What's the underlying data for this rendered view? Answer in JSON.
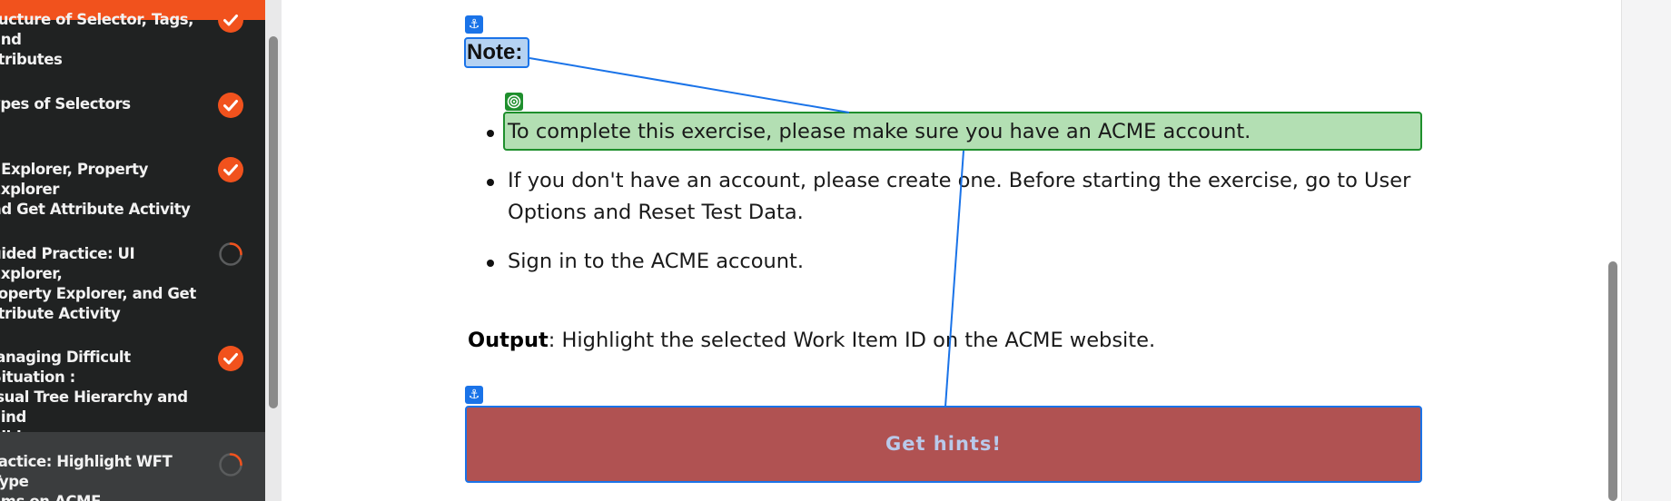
{
  "sidebar": {
    "lessons": [
      {
        "title": "ructure of Selector, Tags, and\nttributes",
        "status": "done"
      },
      {
        "title": "ypes of Selectors",
        "status": "done"
      },
      {
        "title": "I Explorer, Property Explorer\nnd Get Attribute Activity",
        "status": "done"
      },
      {
        "title": "uided Practice: UI Explorer,\nroperty Explorer, and Get\nttribute Activity",
        "status": "in-progress"
      },
      {
        "title": "lanaging Difficult Situation :\nisual Tree Hierarchy and Find\nhildren",
        "status": "done"
      },
      {
        "title": "ractice: Highlight WFT Type\nems on ACME",
        "status": "in-progress",
        "active": true
      }
    ]
  },
  "content": {
    "note_label": "Note:",
    "anchor_icon": "⚓",
    "notes": [
      "To complete this exercise, please make sure you have an ACME account.",
      "If you don't have an account, please create one. Before starting the exercise, go to User Options and Reset Test Data.",
      "Sign in to the ACME account."
    ],
    "output_label": "Output",
    "output_text": ": Highlight the selected Work Item ID on the ACME website.",
    "hint_button_label": "Get hints!"
  },
  "colors": {
    "accent": "#f1521d",
    "anchor_blue": "#1a73e8",
    "target_green": "#1f8f2d",
    "hint_red": "#b05252"
  }
}
